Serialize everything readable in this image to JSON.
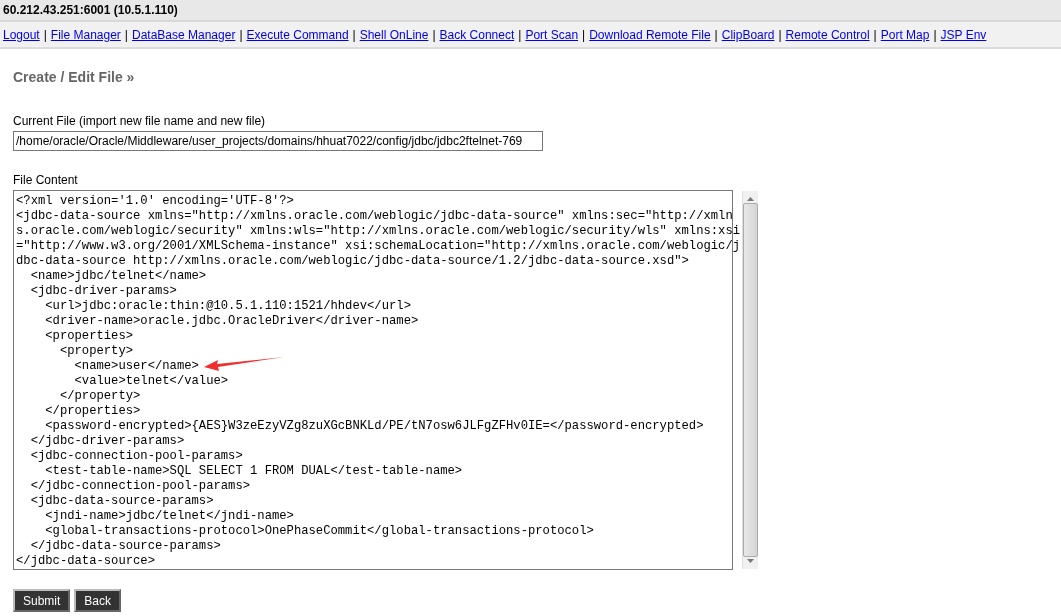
{
  "window": {
    "title": "60.212.43.251:6001 (10.5.1.110)"
  },
  "nav_separator": "|",
  "nav_links": [
    "Logout",
    "File Manager",
    "DataBase Manager",
    "Execute Command",
    "Shell OnLine",
    "Back Connect",
    "Port Scan",
    "Download Remote File",
    "ClipBoard",
    "Remote Control",
    "Port Map",
    "JSP Env"
  ],
  "heading": "Create / Edit File »",
  "current_file": {
    "label": "Current File (import new file name and new file)",
    "value": "/home/oracle/Oracle/Middleware/user_projects/domains/hhuat7022/config/jdbc/jdbc2ftelnet-769"
  },
  "file_content": {
    "label": "File Content",
    "lines": [
      "<?xml version='1.0' encoding='UTF-8'?>",
      "<jdbc-data-source xmlns=\"http://xmlns.oracle.com/weblogic/jdbc-data-source\" xmlns:sec=\"http://xmln",
      "s.oracle.com/weblogic/security\" xmlns:wls=\"http://xmlns.oracle.com/weblogic/security/wls\" xmlns:xsi",
      "=\"http://www.w3.org/2001/XMLSchema-instance\" xsi:schemaLocation=\"http://xmlns.oracle.com/weblogic/j",
      "dbc-data-source http://xmlns.oracle.com/weblogic/jdbc-data-source/1.2/jdbc-data-source.xsd\">",
      "  <name>jdbc/telnet</name>",
      "  <jdbc-driver-params>",
      "    <url>jdbc:oracle:thin:@10.5.1.110:1521/hhdev</url>",
      "    <driver-name>oracle.jdbc.OracleDriver</driver-name>",
      "    <properties>",
      "      <property>",
      "        <name>user</name>",
      "        <value>telnet</value>",
      "      </property>",
      "    </properties>",
      "    <password-encrypted>{AES}W3zeEzyVZg8zuXGcBNKLd/PE/tN7osw6JLFgZFHv0IE=</password-encrypted>",
      "  </jdbc-driver-params>",
      "  <jdbc-connection-pool-params>",
      "    <test-table-name>SQL SELECT 1 FROM DUAL</test-table-name>",
      "  </jdbc-connection-pool-params>",
      "  <jdbc-data-source-params>",
      "    <jndi-name>jdbc/telnet</jndi-name>",
      "    <global-transactions-protocol>OnePhaseCommit</global-transactions-protocol>",
      "  </jdbc-data-source-params>",
      "</jdbc-data-source>"
    ]
  },
  "buttons": [
    "Submit",
    "Back"
  ]
}
